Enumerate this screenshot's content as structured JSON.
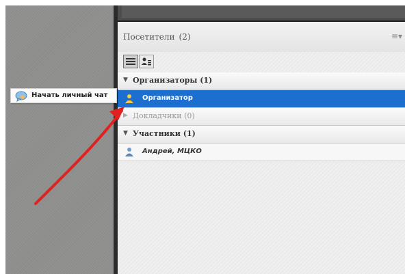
{
  "panel": {
    "title": "Посетители",
    "count": "(2)",
    "menu_icon": "menu-icon"
  },
  "toolbar": {
    "list_view_icon": "list-view-icon",
    "user_view_icon": "user-view-icon"
  },
  "groups": [
    {
      "label": "Организаторы (1)",
      "expanded": true,
      "members": [
        "Организатор"
      ]
    },
    {
      "label": "Докладчики (0)",
      "expanded": false,
      "members": []
    },
    {
      "label": "Участники (1)",
      "expanded": true,
      "members": [
        "Андрей, МЦКО"
      ]
    }
  ],
  "tooltip": {
    "label": "Начать личный чат",
    "icon": "chat-bubble-icon"
  },
  "colors": {
    "selection": "#1c6fcf",
    "arrow": "#e32020",
    "gray_panel": "#8d8d8b"
  }
}
